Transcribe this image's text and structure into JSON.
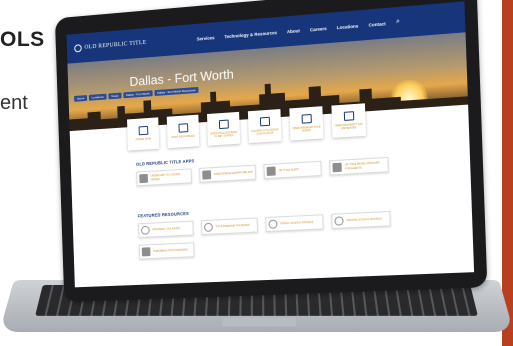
{
  "slide": {
    "heading_fragment": "OLS",
    "body_fragment": "ent",
    "accent_color": "#b8401f"
  },
  "website": {
    "logo_text": "OLD REPUBLIC TITLE",
    "brand_color": "#16357a",
    "link_color": "#c88b1b",
    "nav": {
      "links": [
        "Services",
        "Technology & Resources",
        "About",
        "Careers",
        "Locations",
        "Contact"
      ],
      "search_icon": "search-icon"
    },
    "breadcrumbs": [
      "Home",
      "Locations",
      "Texas",
      "Dallas - Fort Worth",
      "Dallas - Fort Worth Resources"
    ],
    "hero_title": "Dallas - Fort Worth",
    "quick_links": [
      {
        "label": "ORDER NOW",
        "icon": "home-icon"
      },
      {
        "label": "RATE RESOURCES",
        "icon": "books-icon"
      },
      {
        "label": "OPEN TITLE ESCROW IN KEY STATES",
        "icon": "document-icon"
      },
      {
        "label": "CLOSING & CLOSINGS CALCULATOR",
        "icon": "calendar-icon"
      },
      {
        "label": "OPEN PREMIUM TITLE RATES",
        "icon": "file-icon"
      },
      {
        "label": "OPEN PROPERTY TAX ESTIMATES",
        "icon": "pencil-icon"
      }
    ],
    "apps_title": "OLD REPUBLIC TITLE APPS",
    "apps": [
      {
        "label": "ORDER APP TO LAUNCH ORDER",
        "icon": "pencil-icon"
      },
      {
        "label": "FREE MOBILE DEPARTURE APP",
        "icon": "pencil-icon"
      },
      {
        "label": "OR TITLE ALERT",
        "icon": "pencil-icon"
      },
      {
        "label": "OR TITLE REVELATION APP FOR AGENTS",
        "icon": "pencil-icon"
      }
    ],
    "resources_title": "FEATURED RESOURCES",
    "resources": [
      {
        "label": "PROPERTY TAX RATES",
        "icon": "search-icon"
      },
      {
        "label": "TITLE PREMIUM TAX RATES",
        "icon": "search-icon"
      },
      {
        "label": "PUBLIC SCHOOL RATINGS",
        "icon": "search-icon"
      },
      {
        "label": "PRIVATE SCHOOL RATINGS",
        "icon": "search-icon"
      },
      {
        "label": "SUBURBAN ROAD MARKERS",
        "icon": "pencil-icon"
      }
    ]
  }
}
